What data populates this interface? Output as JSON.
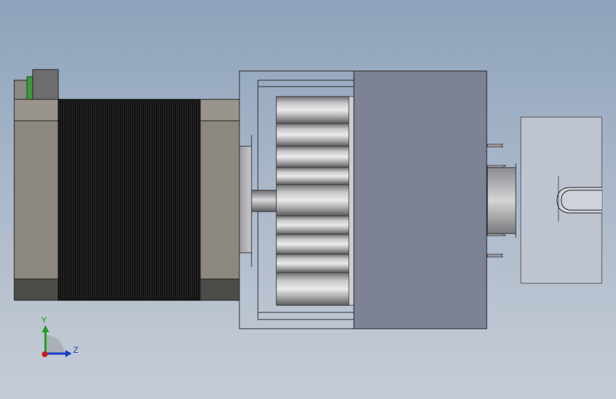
{
  "triad": {
    "y_label": "Y",
    "z_label": "Z"
  },
  "colors": {
    "background_top": "#8da2bb",
    "background_bottom": "#c6ccd6",
    "motor_body": "#8c877f",
    "motor_fins": "#0d0d0d",
    "connector_green": "#3a9a3a",
    "housing_cover": "#7d8294",
    "axis_y": "#1aa01a",
    "axis_z": "#1a3cc8",
    "axis_x": "#cc1a1a"
  }
}
